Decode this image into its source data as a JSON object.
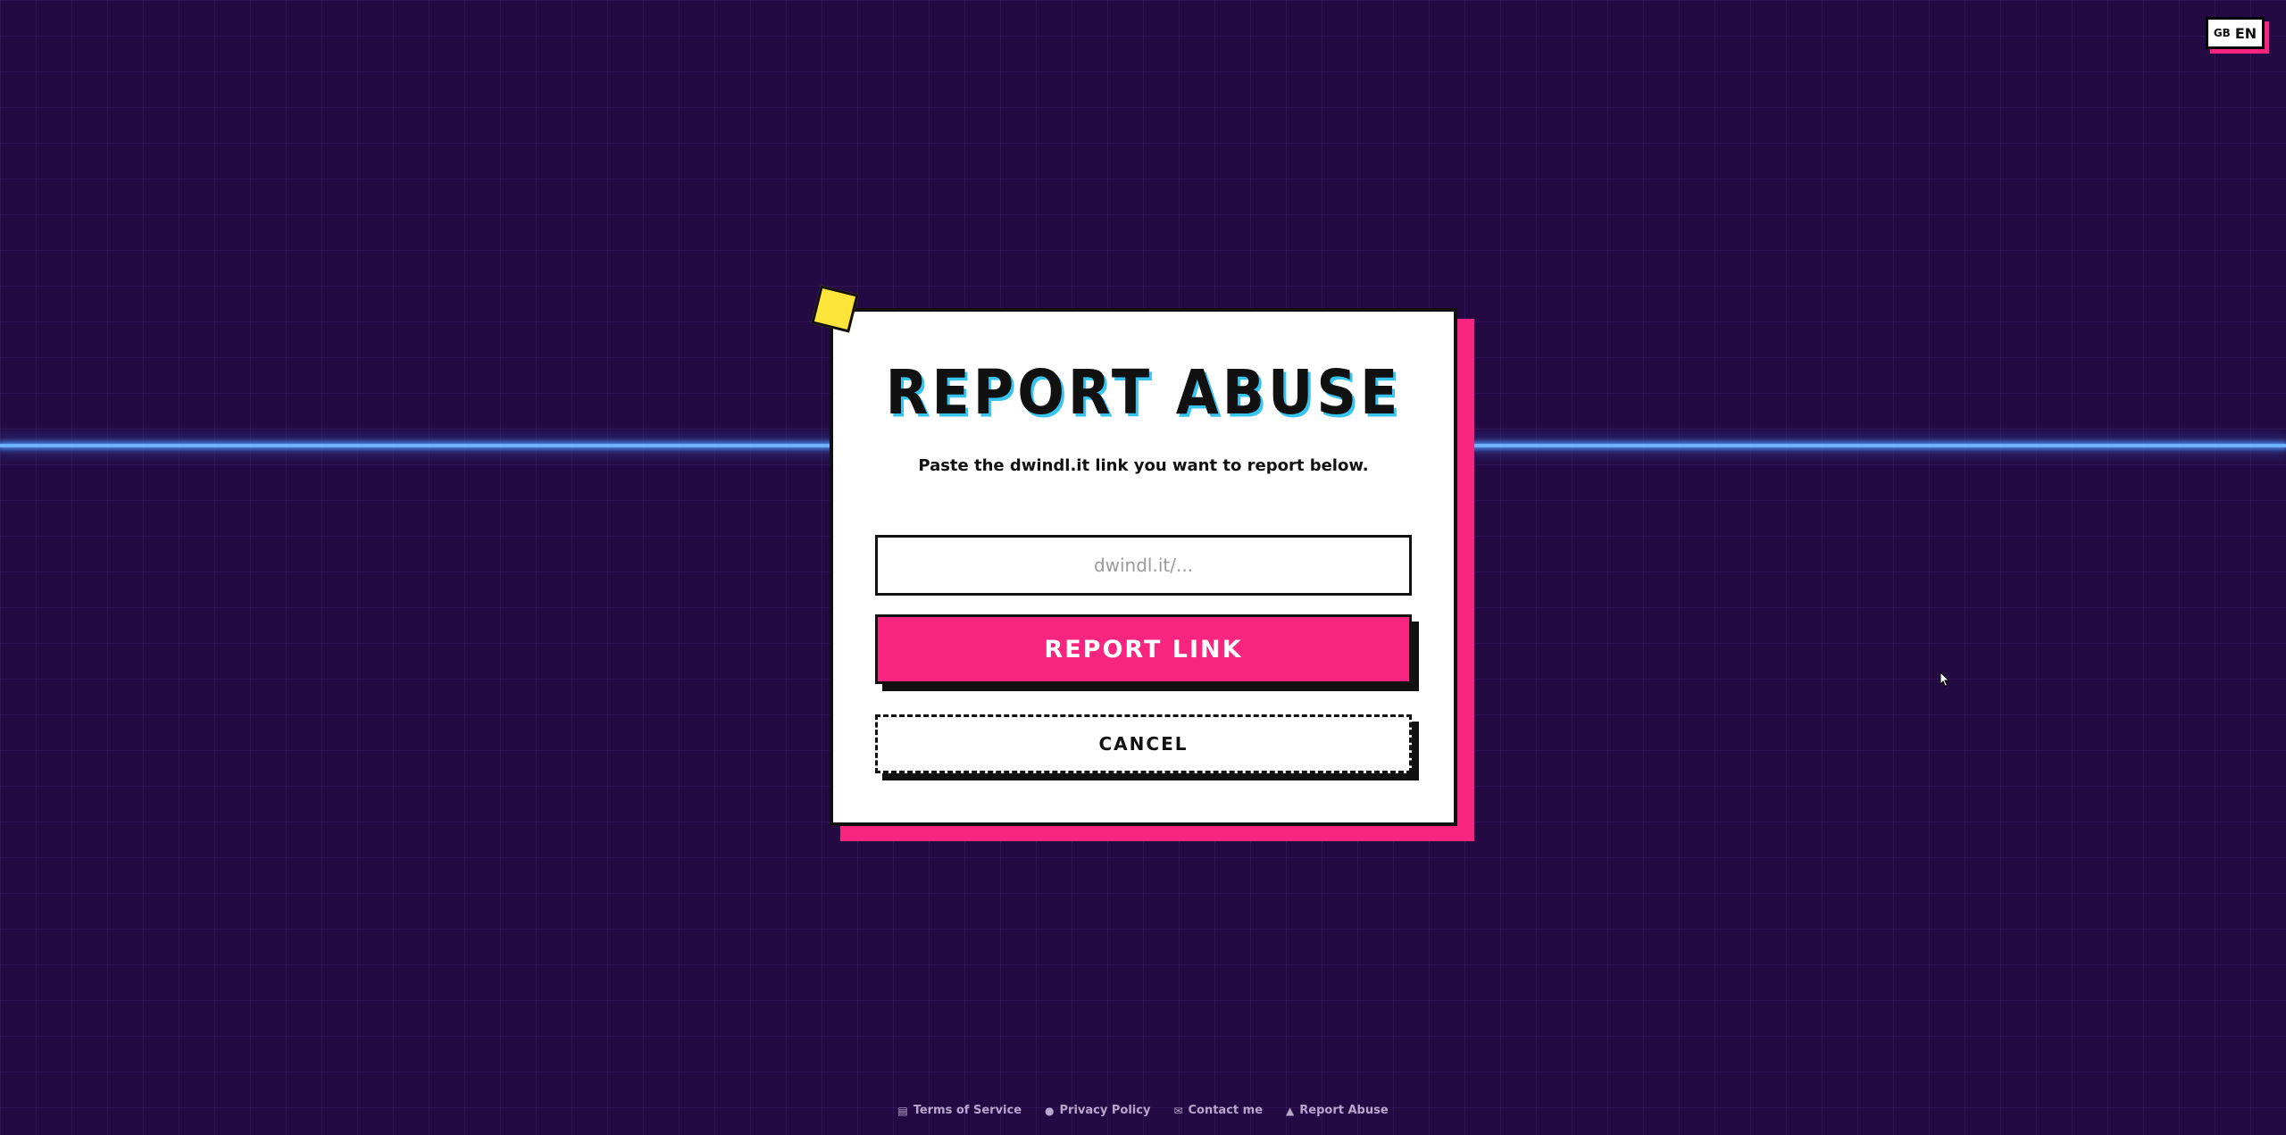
{
  "language": {
    "flag": "GB",
    "code": "EN"
  },
  "dialog": {
    "title": "REPORT ABUSE",
    "subtitle": "Paste the dwindl.it link you want to report below.",
    "input_placeholder": "dwindl.it/...",
    "input_value": "",
    "report_label": "REPORT LINK",
    "cancel_label": "CANCEL"
  },
  "footer": {
    "links": [
      {
        "icon": "scroll-icon",
        "label": "Terms of Service"
      },
      {
        "icon": "detective-icon",
        "label": "Privacy Policy"
      },
      {
        "icon": "envelope-icon",
        "label": "Contact me"
      },
      {
        "icon": "siren-icon",
        "label": "Report Abuse"
      }
    ]
  },
  "colors": {
    "background": "#230a43",
    "accent_pink": "#f7257f",
    "accent_yellow": "#ffe53a",
    "accent_cyan": "#37c4ee",
    "scanline_blue": "#6fb2ff"
  }
}
